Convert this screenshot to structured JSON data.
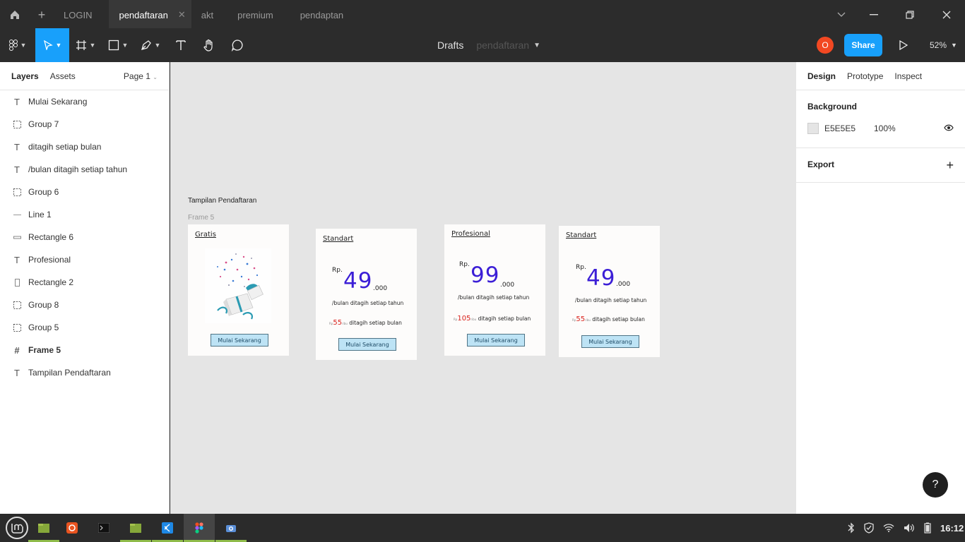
{
  "tabs": {
    "items": [
      "LOGIN",
      "pendaftaran",
      "akt",
      "premium",
      "pendaptan"
    ]
  },
  "toolbar": {
    "location": "Drafts",
    "file_name": "pendaftaran",
    "avatar_letter": "O",
    "share_label": "Share",
    "zoom": "52%"
  },
  "left_panel": {
    "tab_layers": "Layers",
    "tab_assets": "Assets",
    "page": "Page 1",
    "layers": [
      {
        "icon": "text-icon",
        "label": "Mulai Sekarang"
      },
      {
        "icon": "group-icon",
        "label": "Group 7"
      },
      {
        "icon": "text-icon",
        "label": "ditagih setiap bulan"
      },
      {
        "icon": "text-icon",
        "label": "/bulan ditagih setiap tahun"
      },
      {
        "icon": "group-icon",
        "label": "Group 6"
      },
      {
        "icon": "line-icon",
        "label": "Line 1"
      },
      {
        "icon": "rectangle-icon",
        "label": "Rectangle 6"
      },
      {
        "icon": "text-icon",
        "label": "Profesional"
      },
      {
        "icon": "rectangle-icon",
        "label": "Rectangle 2"
      },
      {
        "icon": "group-icon",
        "label": "Group 8"
      },
      {
        "icon": "group-icon",
        "label": "Group 5"
      },
      {
        "icon": "frame-icon",
        "label": "Frame 5"
      },
      {
        "icon": "text-icon",
        "label": "Tampilan Pendaftaran"
      }
    ]
  },
  "right_panel": {
    "tabs": [
      "Design",
      "Prototype",
      "Inspect"
    ],
    "background_heading": "Background",
    "background_hex": "E5E5E5",
    "background_opacity": "100%",
    "export_heading": "Export"
  },
  "canvas": {
    "page_title": "Tampilan Pendaftaran",
    "frame_label": "Frame 5",
    "cards": {
      "gratis": {
        "title": "Gratis",
        "button": "Mulai Sekarang"
      },
      "standart1": {
        "title": "Standart",
        "rp": "Rp.",
        "price": "49",
        "suffix": ".000",
        "desc": "/bulan ditagih setiap tahun",
        "alt_rp": "Rp",
        "alt_price": "55",
        "alt_unit": "ribu",
        "alt_desc": "ditagih setiap bulan",
        "button": "Mulai Sekarang"
      },
      "profesional": {
        "title": "Profesional",
        "rp": "Rp.",
        "price": "99",
        "suffix": ".000",
        "desc": "/bulan ditagih setiap tahun",
        "alt_rp": "Rp",
        "alt_price": "105",
        "alt_unit": "ribu",
        "alt_desc": "ditagih setiap bulan",
        "button": "Mulai Sekarang"
      },
      "standart2": {
        "title": "Standart",
        "rp": "Rp.",
        "price": "49",
        "suffix": ".000",
        "desc": "/bulan ditagih setiap tahun",
        "alt_rp": "Rp",
        "alt_price": "55",
        "alt_unit": "ribu",
        "alt_desc": "ditagih setiap bulan",
        "button": "Mulai Sekarang"
      }
    }
  },
  "help_label": "?",
  "taskbar": {
    "clock": "16:12"
  },
  "colors": {
    "accent": "#18a0fb",
    "avatar": "#f24822",
    "price_purple": "#3b1ed6",
    "price_red": "#d9231d"
  }
}
